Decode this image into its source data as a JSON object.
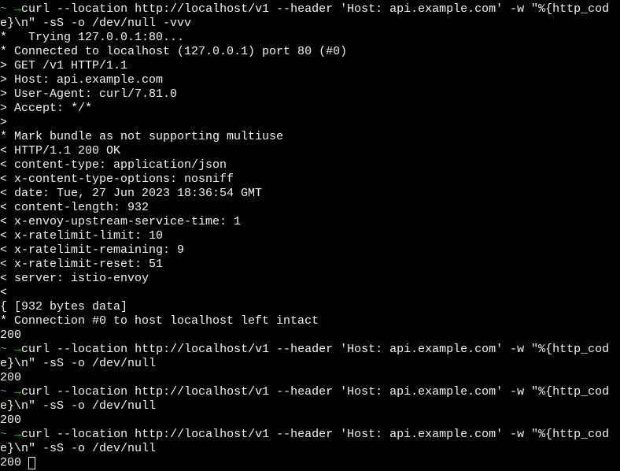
{
  "colors": {
    "background": "#000000",
    "foreground": "#f2f2f2",
    "prompt_tilde": "#2aa1b3",
    "prompt_arrow": "#26c43a"
  },
  "prompt": {
    "dir": "~",
    "arrow": "→"
  },
  "lines": [
    {
      "type": "cmd",
      "text": "curl --location http://localhost/v1 --header 'Host: api.example.com' -w \"%{http_cod"
    },
    {
      "type": "out",
      "text": "e}\\n\" -sS -o /dev/null -vvv"
    },
    {
      "type": "out",
      "text": "*   Trying 127.0.0.1:80..."
    },
    {
      "type": "out",
      "text": "* Connected to localhost (127.0.0.1) port 80 (#0)"
    },
    {
      "type": "out",
      "text": "> GET /v1 HTTP/1.1"
    },
    {
      "type": "out",
      "text": "> Host: api.example.com"
    },
    {
      "type": "out",
      "text": "> User-Agent: curl/7.81.0"
    },
    {
      "type": "out",
      "text": "> Accept: */*"
    },
    {
      "type": "out",
      "text": ">"
    },
    {
      "type": "out",
      "text": "* Mark bundle as not supporting multiuse"
    },
    {
      "type": "out",
      "text": "< HTTP/1.1 200 OK"
    },
    {
      "type": "out",
      "text": "< content-type: application/json"
    },
    {
      "type": "out",
      "text": "< x-content-type-options: nosniff"
    },
    {
      "type": "out",
      "text": "< date: Tue, 27 Jun 2023 18:36:54 GMT"
    },
    {
      "type": "out",
      "text": "< content-length: 932"
    },
    {
      "type": "out",
      "text": "< x-envoy-upstream-service-time: 1"
    },
    {
      "type": "out",
      "text": "< x-ratelimit-limit: 10"
    },
    {
      "type": "out",
      "text": "< x-ratelimit-remaining: 9"
    },
    {
      "type": "out",
      "text": "< x-ratelimit-reset: 51"
    },
    {
      "type": "out",
      "text": "< server: istio-envoy"
    },
    {
      "type": "out",
      "text": "<"
    },
    {
      "type": "out",
      "text": "{ [932 bytes data]"
    },
    {
      "type": "out",
      "text": "* Connection #0 to host localhost left intact"
    },
    {
      "type": "out",
      "text": "200"
    },
    {
      "type": "cmd",
      "text": "curl --location http://localhost/v1 --header 'Host: api.example.com' -w \"%{http_cod"
    },
    {
      "type": "out",
      "text": "e}\\n\" -sS -o /dev/null"
    },
    {
      "type": "out",
      "text": "200"
    },
    {
      "type": "cmd",
      "text": "curl --location http://localhost/v1 --header 'Host: api.example.com' -w \"%{http_cod"
    },
    {
      "type": "out",
      "text": "e}\\n\" -sS -o /dev/null"
    },
    {
      "type": "out",
      "text": "200"
    },
    {
      "type": "cmd",
      "text": "curl --location http://localhost/v1 --header 'Host: api.example.com' -w \"%{http_cod"
    },
    {
      "type": "out",
      "text": "e}\\n\" -sS -o /dev/null"
    },
    {
      "type": "out",
      "text": "200",
      "cursor": true
    }
  ]
}
